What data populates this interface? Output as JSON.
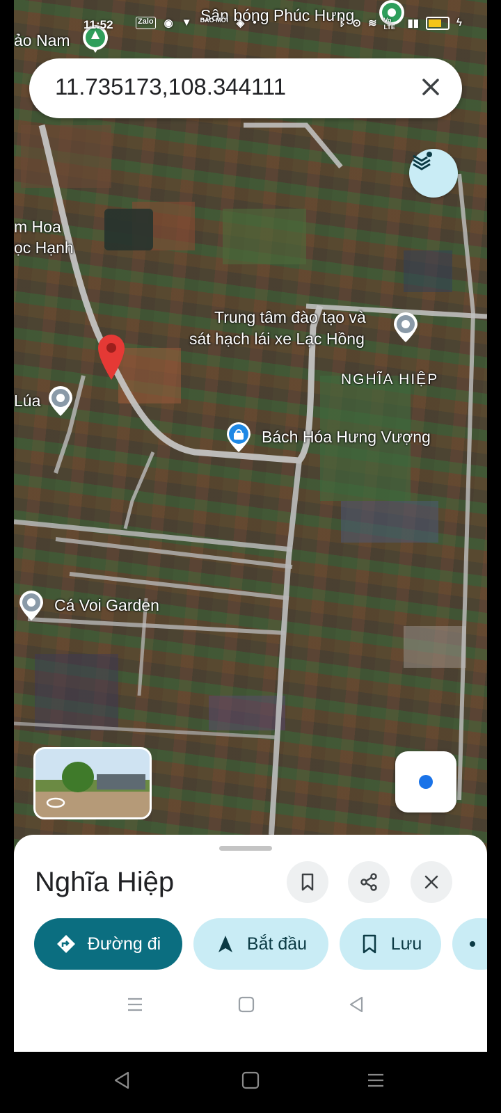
{
  "status_bar": {
    "time": "11:52",
    "app_icons": [
      "Zalo",
      "messenger",
      "shield",
      "BÁO MỚI",
      "browser",
      "dot"
    ],
    "network": "Vo LTE"
  },
  "search": {
    "query": "11.735173,108.344111"
  },
  "map_labels": {
    "san_bong": "Sân bóng Phúc Hưng",
    "dao_nam": "ảo Nam",
    "hoa_line1": "m Hoa",
    "hoa_line2": "ọc Hạnh",
    "trung_tam_line1": "Trung tâm đào tạo và",
    "trung_tam_line2": "sát hạch lái xe Lạc Hồng",
    "nghia_hiep": "NGHĨA HIỆP",
    "lua": "Lúa",
    "bach_hoa": "Bách Hóa Hưng Vượng",
    "ca_voi": "Cá Voi Garden"
  },
  "sheet": {
    "title": "Nghĩa Hiệp",
    "chips": {
      "directions": "Đường đi",
      "start": "Bắt đầu",
      "save": "Lưu"
    }
  },
  "colors": {
    "primary": "#0b6e80",
    "chip_light": "#c9ecf5",
    "pin_red": "#e53935",
    "location_blue": "#1a73e8"
  }
}
